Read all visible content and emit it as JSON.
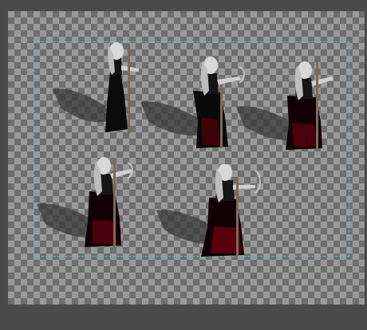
{
  "canvas": {
    "checker_dark": "#6e6e6e",
    "checker_light": "#9a9a9a",
    "background": "#4a4a4a"
  },
  "layer": {
    "boundary_color": "#46c8d0"
  },
  "sprites": [
    {
      "name": "sprite-figure-1",
      "dress_color": "#0a0a0a",
      "accent_color": "#3a0000"
    },
    {
      "name": "sprite-figure-2",
      "dress_color": "#0a0a0a",
      "accent_color": "#4a0008"
    },
    {
      "name": "sprite-figure-3",
      "dress_color": "#120004",
      "accent_color": "#5a0010"
    },
    {
      "name": "sprite-figure-4",
      "dress_color": "#120004",
      "accent_color": "#5a0010"
    },
    {
      "name": "sprite-figure-5",
      "dress_color": "#120004",
      "accent_color": "#6a0012"
    }
  ]
}
